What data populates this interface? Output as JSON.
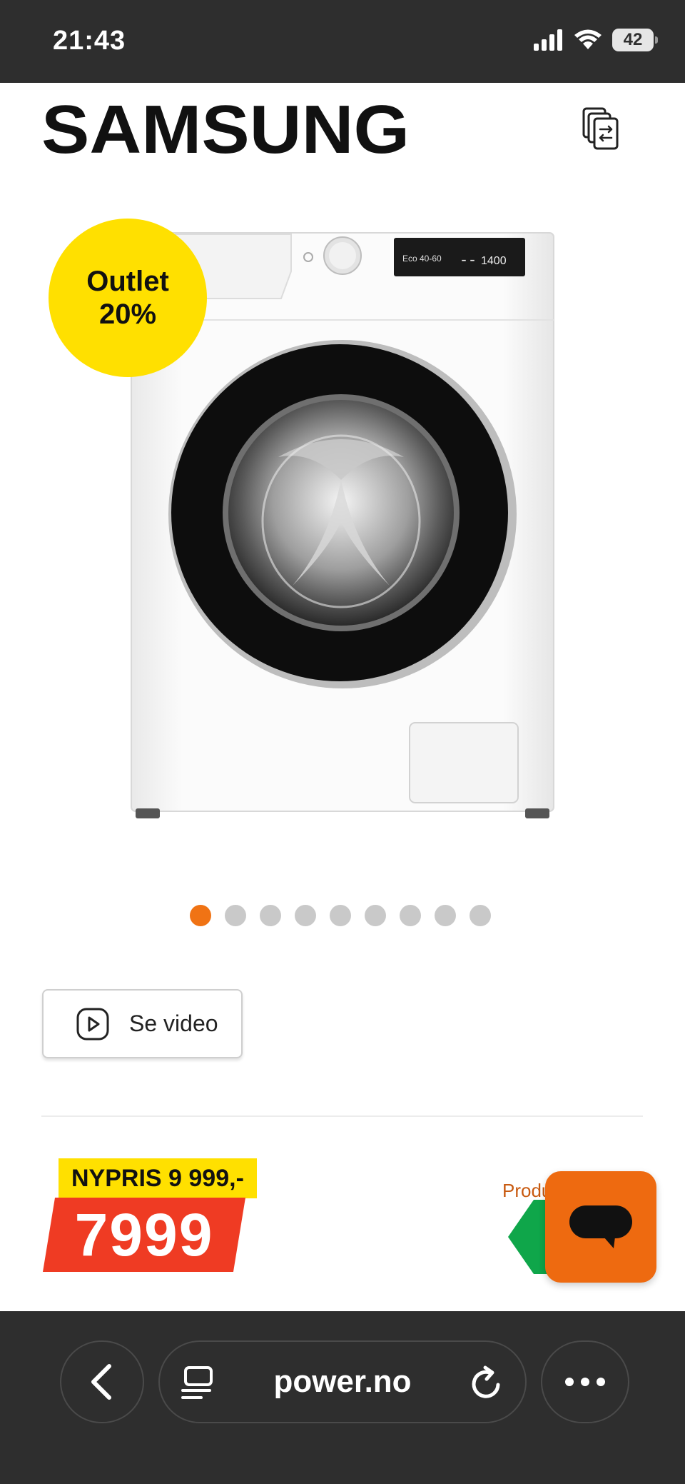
{
  "status_bar": {
    "time": "21:43",
    "battery": "42"
  },
  "header": {
    "brand": "SAMSUNG"
  },
  "product": {
    "badge_line1": "Outlet",
    "badge_line2": "20%",
    "panel_display": "Eco 40-60",
    "panel_spin": "1400",
    "image_count": 9,
    "active_image": 1
  },
  "video_button": {
    "label": "Se video"
  },
  "price": {
    "old_price": "NYPRIS 9 999,-",
    "current": "7999",
    "energy_label_text": "Produ"
  },
  "browser": {
    "url": "power.no"
  },
  "colors": {
    "accent_orange": "#f07314",
    "badge_yellow": "#ffe000",
    "price_red": "#ef3b23",
    "energy_green": "#0fa64a",
    "chrome_dark": "#2e2e2e"
  },
  "icons": {
    "compare": "compare-icon",
    "video": "play-icon",
    "chat": "chat-icon",
    "back": "chevron-left-icon",
    "tabs": "tabs-icon",
    "reload": "reload-icon",
    "more": "more-icon"
  }
}
